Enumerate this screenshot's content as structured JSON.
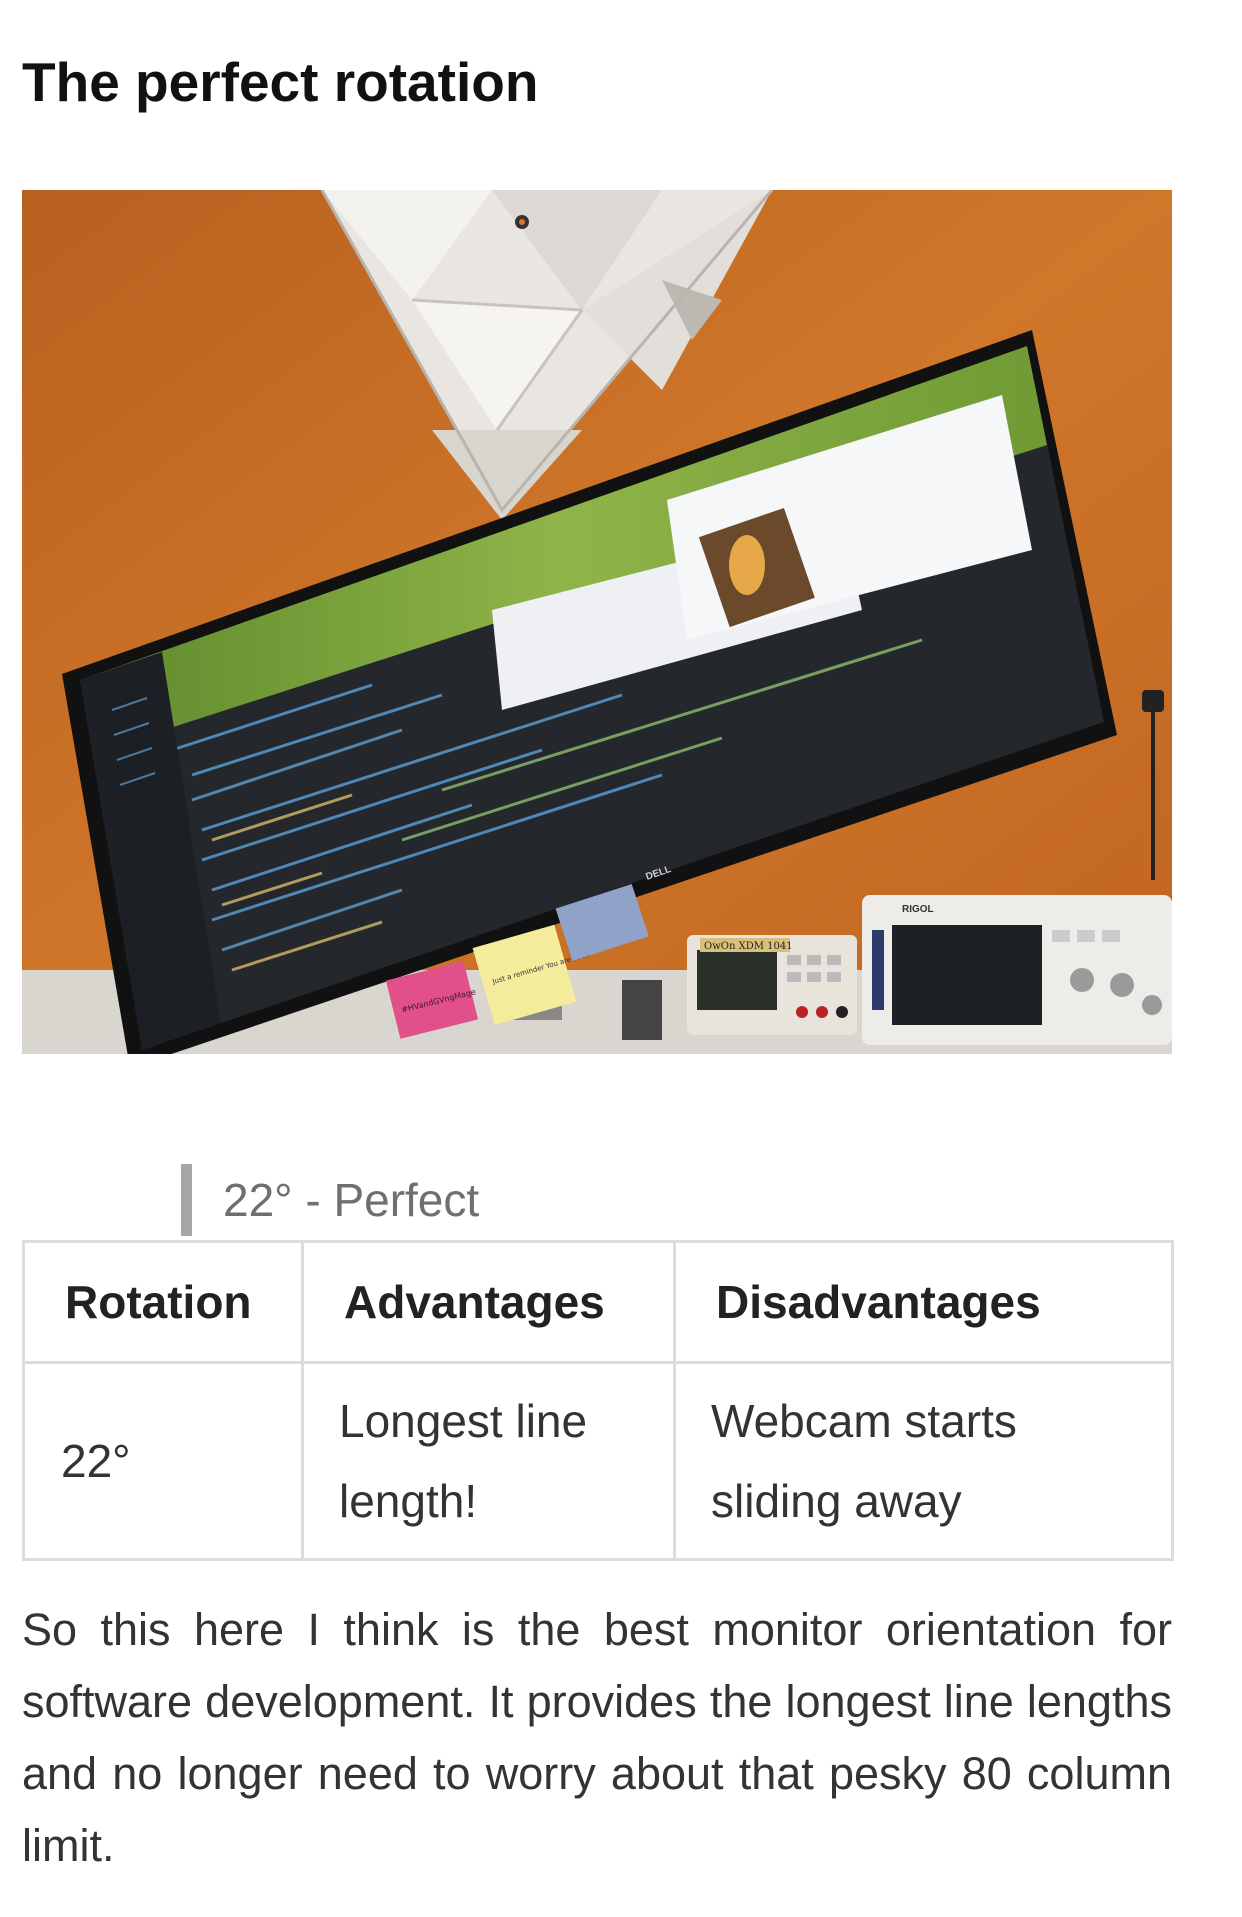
{
  "article": {
    "title": "The perfect rotation",
    "photo": {
      "monitor_brand": "DELL",
      "meter_label": "OwOn  XDM 1041",
      "scope_label": "RIGOL",
      "sticky_pink_text": "#HVandGVngMage",
      "sticky_yellow_text": "Just a reminder You are cute!"
    },
    "caption": "22° - Perfect",
    "table": {
      "headers": [
        "Rotation",
        "Advantages",
        "Disadvantages"
      ],
      "rows": [
        {
          "rotation": "22°",
          "advantages": "Longest line length!",
          "disadvantages": "Webcam starts sliding away"
        }
      ]
    },
    "paragraph": "So this here I think is the best monitor orientation for software development. It provides the longest line lengths and no longer need to worry about that pesky 80 column limit."
  },
  "colors": {
    "wall": "#c56a22",
    "caption_bar": "#a6a6a6",
    "table_border": "#dcdcdc"
  }
}
